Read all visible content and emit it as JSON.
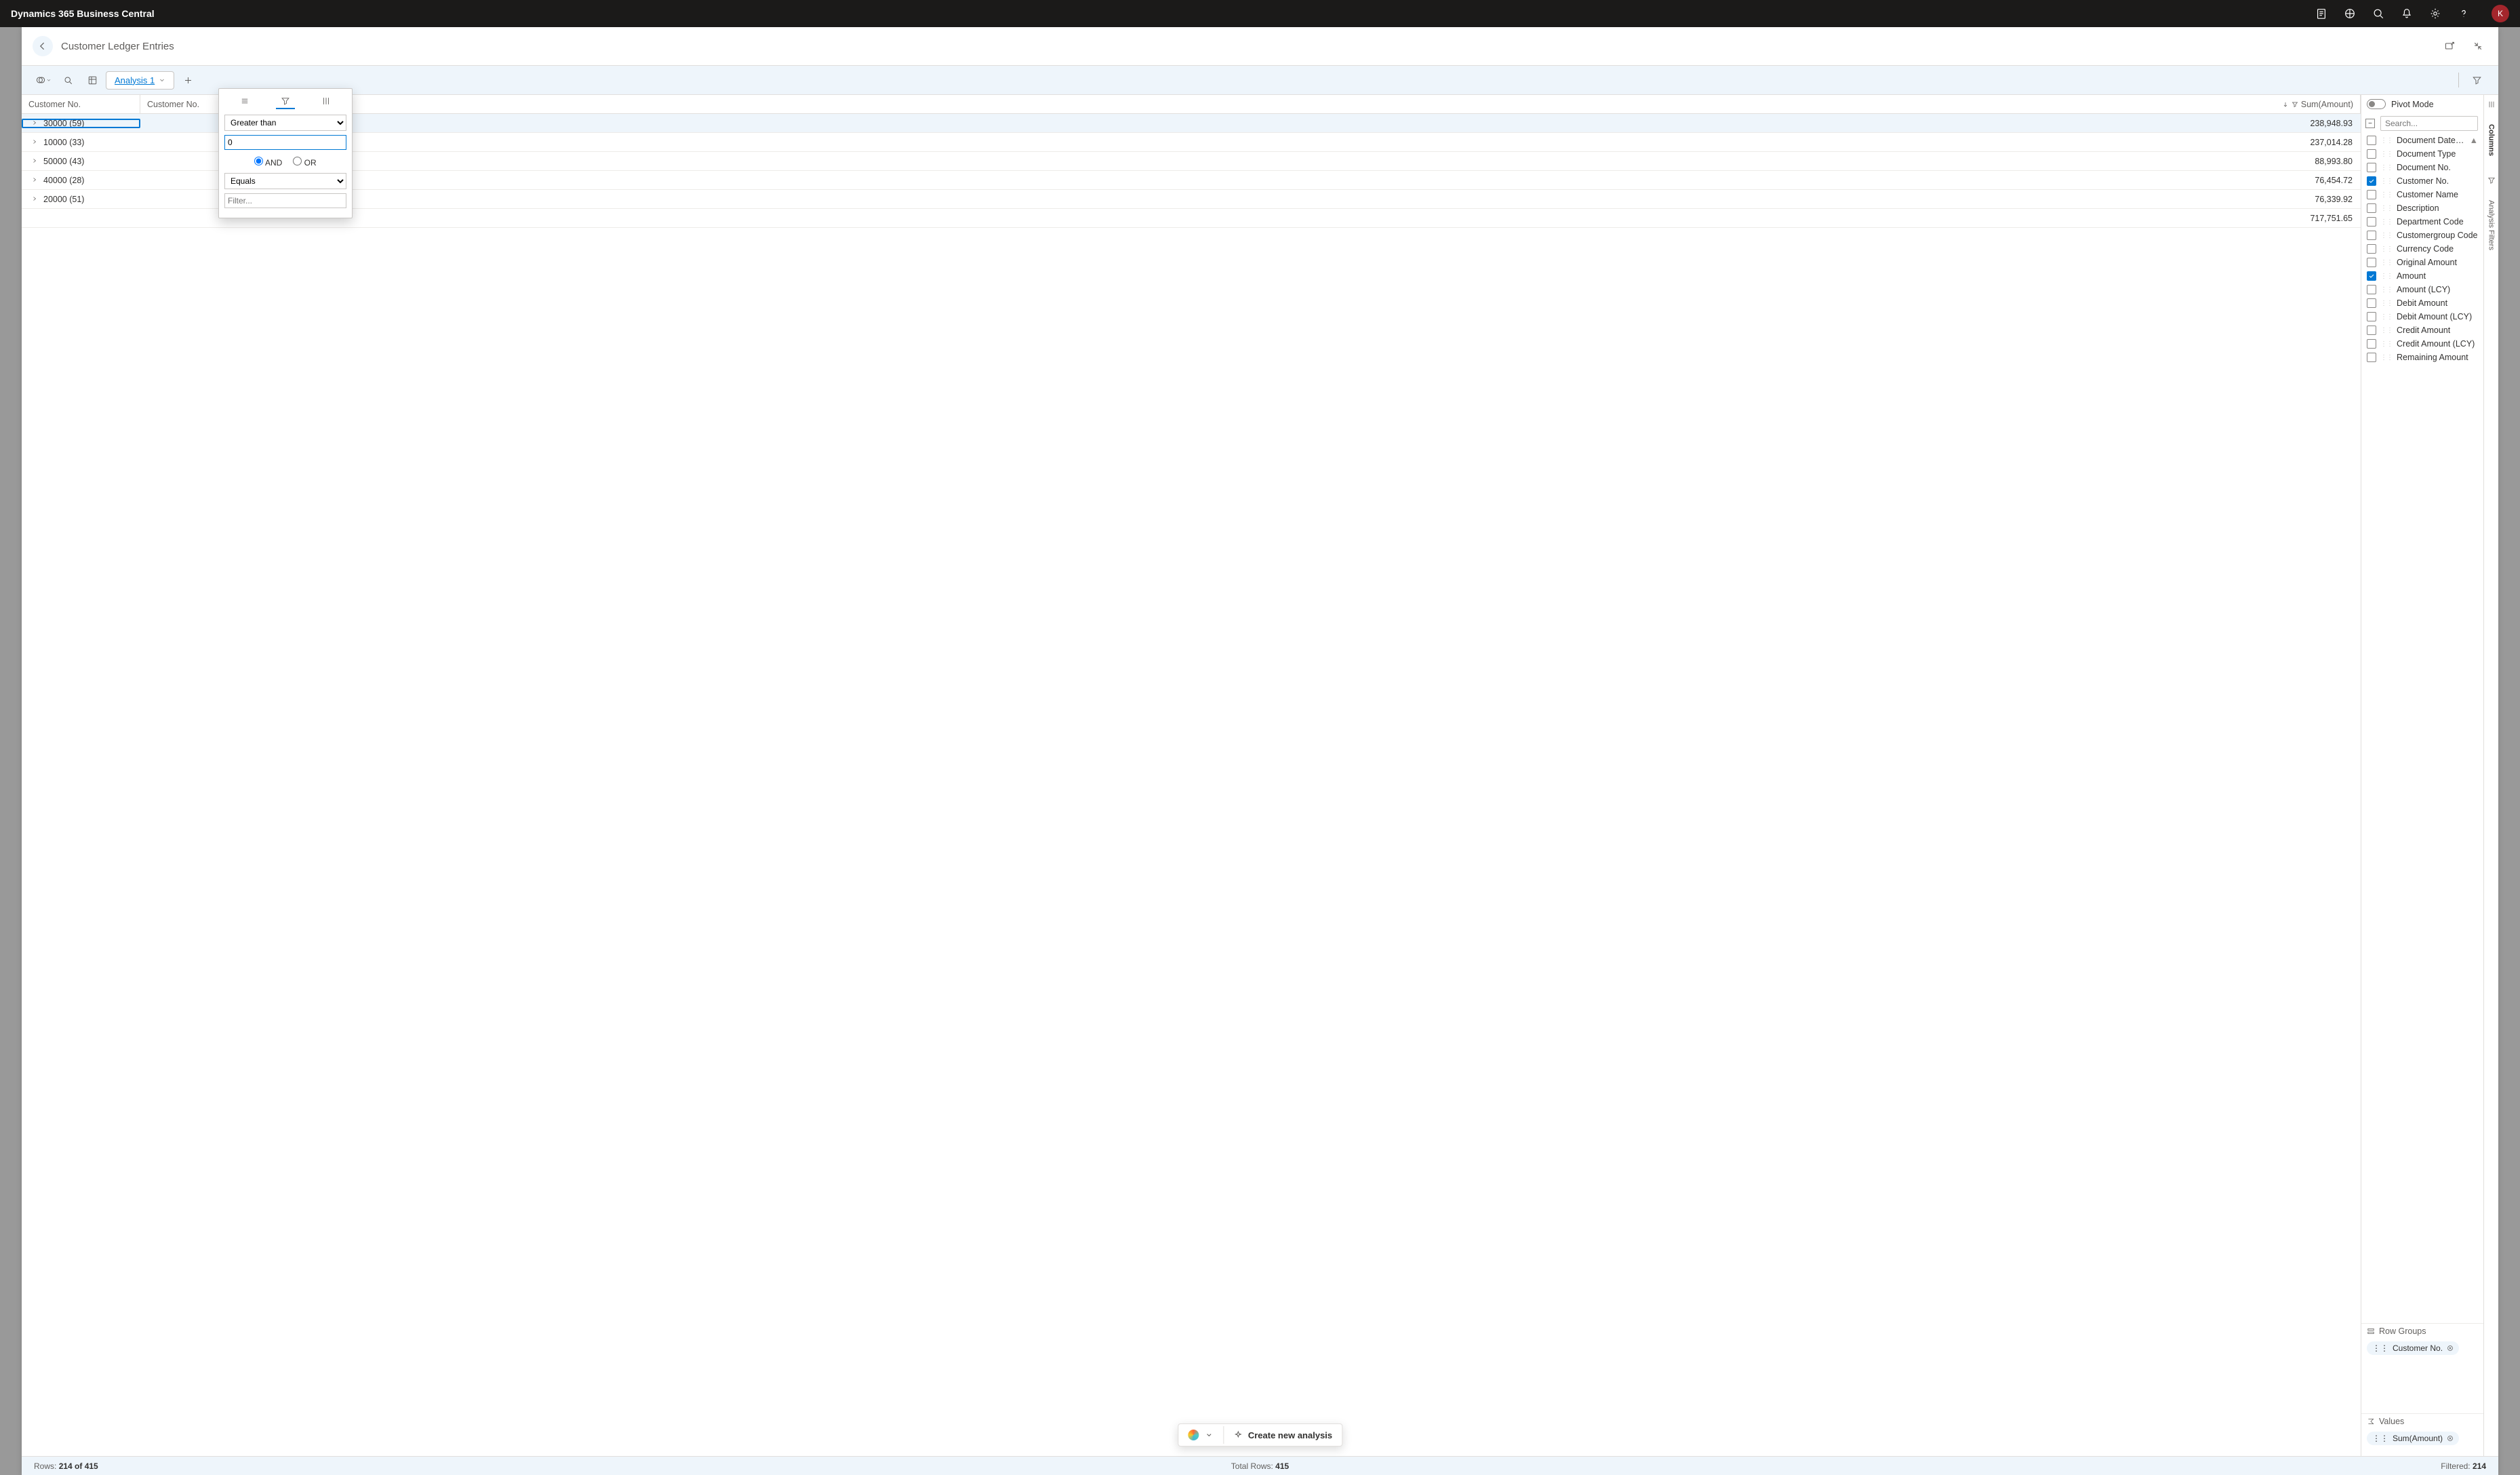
{
  "topbar": {
    "app_title": "Dynamics 365 Business Central",
    "avatar_initial": "K"
  },
  "page": {
    "title": "Customer Ledger Entries",
    "active_tab": "Analysis 1"
  },
  "filter_popup": {
    "condition1": "Greater than",
    "value1": "0",
    "logic_and": "AND",
    "logic_or": "OR",
    "condition2": "Equals",
    "value2_placeholder": "Filter..."
  },
  "grid_headers": {
    "col1": "Customer No.",
    "col2": "Customer No.",
    "col3": "Sum(Amount)"
  },
  "rows": [
    {
      "group": "30000",
      "count": "(59)",
      "amount": "238,948.93"
    },
    {
      "group": "10000",
      "count": "(33)",
      "amount": "237,014.28"
    },
    {
      "group": "50000",
      "count": "(43)",
      "amount": "88,993.80"
    },
    {
      "group": "40000",
      "count": "(28)",
      "amount": "76,454.72"
    },
    {
      "group": "20000",
      "count": "(51)",
      "amount": "76,339.92"
    }
  ],
  "total_amount": "717,751.65",
  "sidepanel": {
    "pivot_label": "Pivot Mode",
    "search_placeholder": "Search...",
    "columns": [
      {
        "name": "Document Date Month",
        "checked": false,
        "sort": "asc"
      },
      {
        "name": "Document Type",
        "checked": false
      },
      {
        "name": "Document No.",
        "checked": false
      },
      {
        "name": "Customer No.",
        "checked": true
      },
      {
        "name": "Customer Name",
        "checked": false
      },
      {
        "name": "Description",
        "checked": false
      },
      {
        "name": "Department Code",
        "checked": false
      },
      {
        "name": "Customergroup Code",
        "checked": false
      },
      {
        "name": "Currency Code",
        "checked": false
      },
      {
        "name": "Original Amount",
        "checked": false
      },
      {
        "name": "Amount",
        "checked": true
      },
      {
        "name": "Amount (LCY)",
        "checked": false
      },
      {
        "name": "Debit Amount",
        "checked": false
      },
      {
        "name": "Debit Amount (LCY)",
        "checked": false
      },
      {
        "name": "Credit Amount",
        "checked": false
      },
      {
        "name": "Credit Amount (LCY)",
        "checked": false
      },
      {
        "name": "Remaining Amount",
        "checked": false
      }
    ],
    "row_groups_label": "Row Groups",
    "row_group_chip": "Customer No.",
    "values_label": "Values",
    "values_chip": "Sum(Amount)",
    "rail_columns": "Columns",
    "rail_filters": "Analysis Filters"
  },
  "floating": {
    "create_label": "Create new analysis"
  },
  "status": {
    "rows_label": "Rows:",
    "rows_value": "214 of 415",
    "total_label": "Total Rows:",
    "total_value": "415",
    "filtered_label": "Filtered:",
    "filtered_value": "214"
  }
}
